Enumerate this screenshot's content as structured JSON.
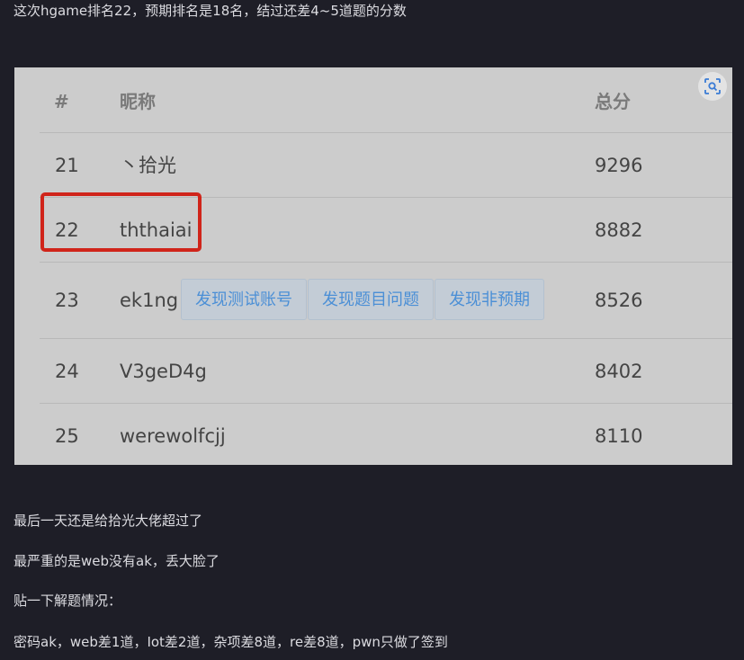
{
  "intro_text": "这次hgame排名22，预期排名是18名，结过还差4~5道题的分数",
  "table": {
    "headers": {
      "rank": "#",
      "nickname": "昵称",
      "score": "总分"
    },
    "rows": [
      {
        "rank": "21",
        "nickname": "丶拾光",
        "score": "9296",
        "tags": []
      },
      {
        "rank": "22",
        "nickname": "ththaiai",
        "score": "8882",
        "tags": [],
        "highlighted": true
      },
      {
        "rank": "23",
        "nickname": "ek1ng",
        "score": "8526",
        "tags": [
          "发现测试账号",
          "发现题目问题",
          "发现非预期"
        ]
      },
      {
        "rank": "24",
        "nickname": "V3geD4g",
        "score": "8402",
        "tags": []
      },
      {
        "rank": "25",
        "nickname": "werewolfcjj",
        "score": "8110",
        "tags": []
      }
    ]
  },
  "highlight_color": "#d0241a",
  "zoom_icon": "scan-zoom-icon",
  "paragraphs": [
    "最后一天还是给拾光大佬超过了",
    "最严重的是web没有ak，丢大脸了",
    "贴一下解题情况：",
    "密码ak，web差1道，Iot差2道，杂项差8道，re差8道，pwn只做了签到"
  ]
}
